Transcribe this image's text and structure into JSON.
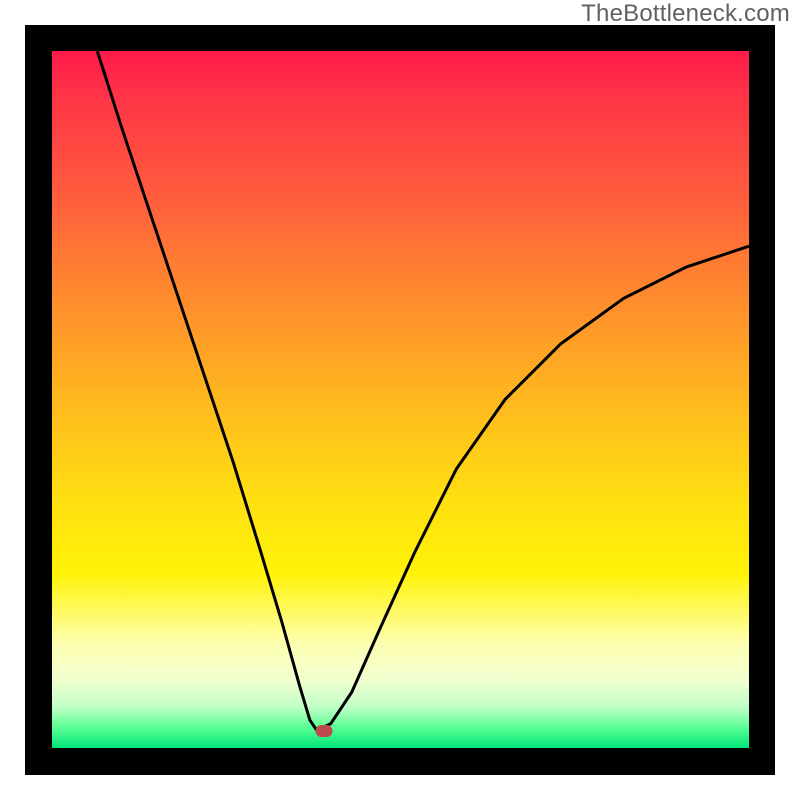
{
  "watermark": {
    "text": "TheBottleneck.com"
  },
  "colors": {
    "frame": "#000000",
    "curve_stroke": "#000000",
    "marker_fill": "#bd4a4a",
    "gradient_stops": [
      "#ff1a4b",
      "#ff3646",
      "#ff5a3e",
      "#ff8a2e",
      "#ffb81f",
      "#ffde12",
      "#fff308",
      "#fdffb0",
      "#f3ffd0",
      "#c4ffc8",
      "#5dff95",
      "#00e579"
    ]
  },
  "chart_data": {
    "type": "line",
    "title": "",
    "xlabel": "",
    "ylabel": "",
    "xlim": [
      0,
      100
    ],
    "ylim": [
      0,
      100
    ],
    "minimum": {
      "x": 38,
      "y": 2.5
    },
    "marker": {
      "x": 39,
      "y": 2.5
    },
    "series": [
      {
        "name": "left-branch",
        "x": [
          6.5,
          10,
          14,
          18,
          22,
          26,
          30,
          33,
          35.5,
          37,
          38
        ],
        "y": [
          100,
          89,
          77,
          65,
          53,
          41,
          28,
          18,
          9,
          4,
          2.5
        ]
      },
      {
        "name": "right-branch",
        "x": [
          38,
          40,
          43,
          47,
          52,
          58,
          65,
          73,
          82,
          91,
          100
        ],
        "y": [
          2.5,
          3.5,
          8,
          17,
          28,
          40,
          50,
          58,
          64.5,
          69,
          72
        ]
      }
    ],
    "annotations": []
  }
}
